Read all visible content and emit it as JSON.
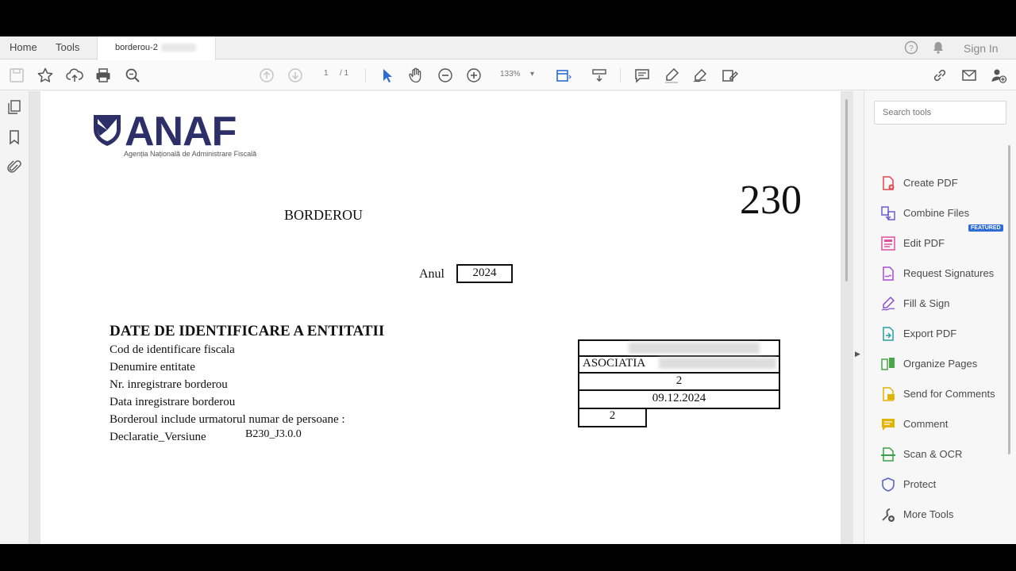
{
  "menu": {
    "home": "Home",
    "tools": "Tools",
    "tab_title": "borderou-2",
    "sign_in": "Sign In"
  },
  "toolbar": {
    "page_current": "1",
    "page_total": "/ 1",
    "zoom": "133%"
  },
  "document": {
    "logo_text": "ANAF",
    "logo_subtitle": "Agenția Națională de Administrare Fiscală",
    "form_number": "230",
    "title": "BORDEROU",
    "year_label": "Anul",
    "year_value": "2024",
    "section_title": "DATE DE IDENTIFICARE A ENTITATII",
    "fields": [
      "Cod de identificare fiscala",
      "Denumire entitate",
      "Nr. inregistrare borderou",
      "Data inregistrare borderou",
      "Borderoul include urmatorul numar de persoane :",
      "Declaratie_Versiune"
    ],
    "values": {
      "entity_name_prefix": "ASOCIATIA",
      "registration_number": "2",
      "registration_date": "09.12.2024",
      "persons_count": "2",
      "version": "B230_J3.0.0"
    }
  },
  "tools_panel": {
    "search_placeholder": "Search tools",
    "featured_badge": "FEATURED",
    "items": [
      {
        "label": "Create PDF",
        "icon": "create-pdf-icon",
        "color": "#e0474c"
      },
      {
        "label": "Combine Files",
        "icon": "combine-files-icon",
        "color": "#6b5bd2"
      },
      {
        "label": "Edit PDF",
        "icon": "edit-pdf-icon",
        "color": "#e04fa0"
      },
      {
        "label": "Request Signatures",
        "icon": "request-signatures-icon",
        "color": "#a74fd0"
      },
      {
        "label": "Fill & Sign",
        "icon": "fill-sign-icon",
        "color": "#8a4fd0"
      },
      {
        "label": "Export PDF",
        "icon": "export-pdf-icon",
        "color": "#26a0a0"
      },
      {
        "label": "Organize Pages",
        "icon": "organize-pages-icon",
        "color": "#4aa64a"
      },
      {
        "label": "Send for Comments",
        "icon": "send-comments-icon",
        "color": "#e0b400"
      },
      {
        "label": "Comment",
        "icon": "comment-icon",
        "color": "#e0b400"
      },
      {
        "label": "Scan & OCR",
        "icon": "scan-ocr-icon",
        "color": "#3aa14a"
      },
      {
        "label": "Protect",
        "icon": "protect-icon",
        "color": "#5a62c4"
      },
      {
        "label": "More Tools",
        "icon": "more-tools-icon",
        "color": "#555555"
      }
    ]
  }
}
